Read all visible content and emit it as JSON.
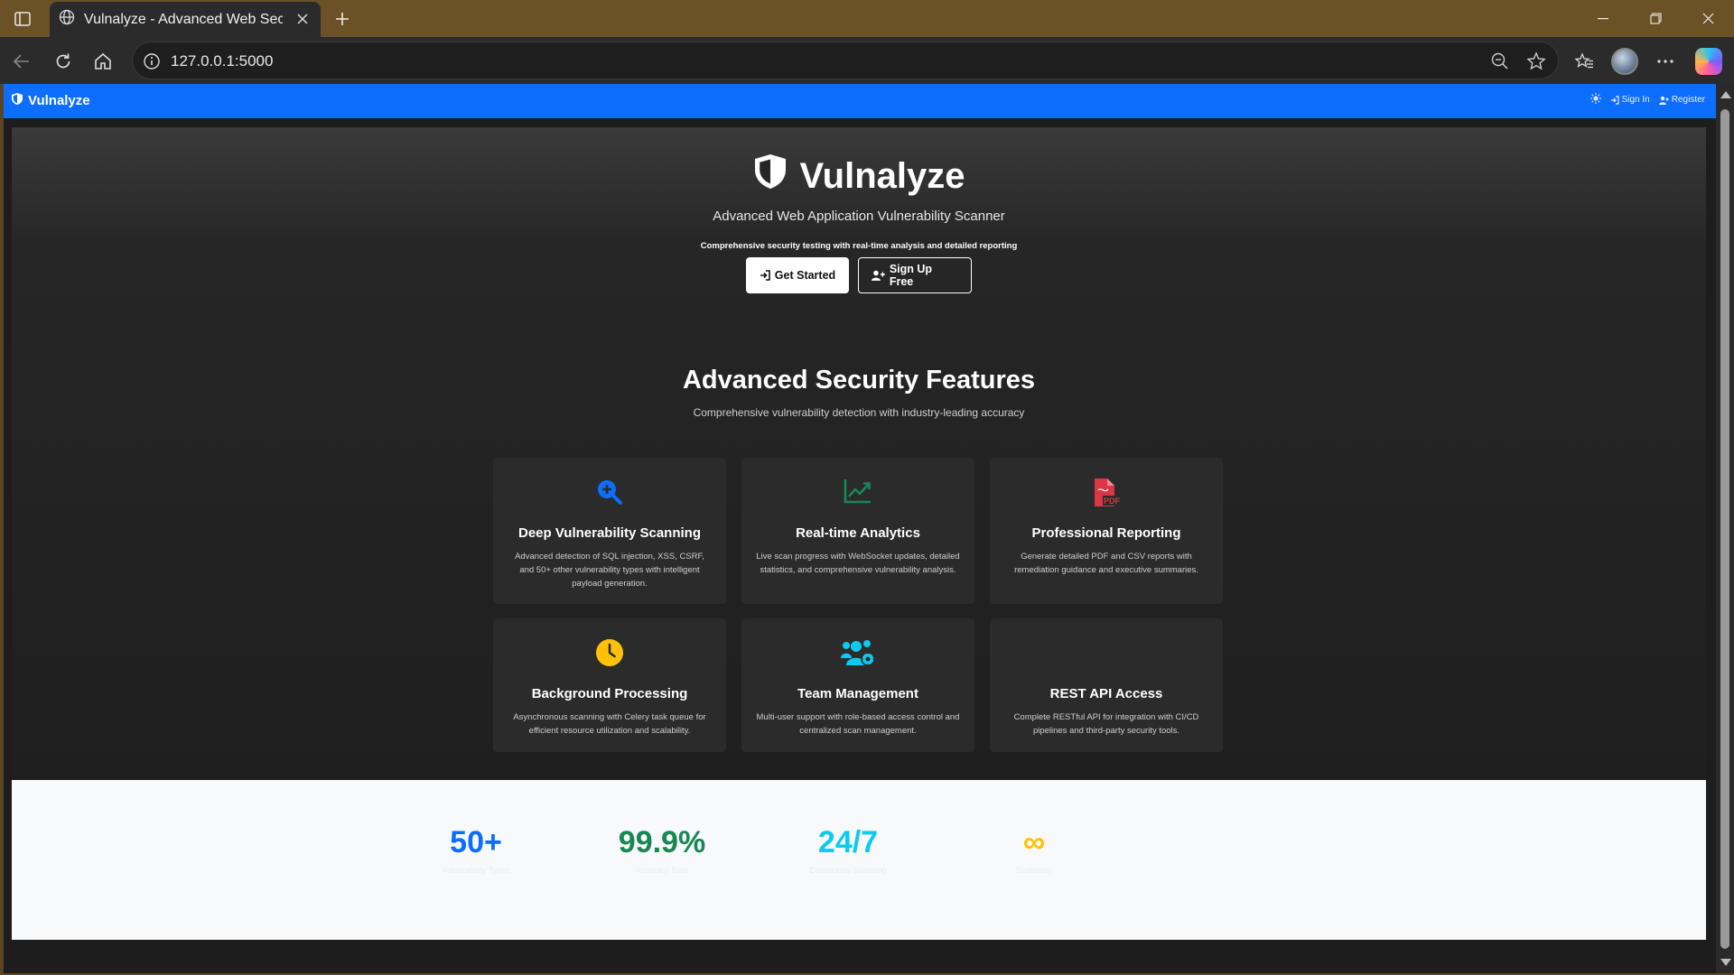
{
  "browser": {
    "tab_title": "Vulnalyze - Advanced Web Security Scanner",
    "url": "127.0.0.1:5000"
  },
  "navbar": {
    "brand": "Vulnalyze",
    "sign_in": "Sign In",
    "register": "Register"
  },
  "hero": {
    "title": "Vulnalyze",
    "subtitle": "Advanced Web Application Vulnerability Scanner",
    "description": "Comprehensive security testing with real-time analysis and detailed reporting",
    "get_started": "Get Started",
    "sign_up": "Sign Up Free"
  },
  "features": {
    "title": "Advanced Security Features",
    "subtitle": "Comprehensive vulnerability detection with industry-leading accuracy",
    "cards": [
      {
        "title": "Deep Vulnerability Scanning",
        "text": "Advanced detection of SQL injection, XSS, CSRF, and 50+ other vulnerability types with intelligent payload generation.",
        "icon": "search-plus-icon",
        "color": "#0d6efd"
      },
      {
        "title": "Real-time Analytics",
        "text": "Live scan progress with WebSocket updates, detailed statistics, and comprehensive vulnerability analysis.",
        "icon": "line-chart-icon",
        "color": "#198754"
      },
      {
        "title": "Professional Reporting",
        "text": "Generate detailed PDF and CSV reports with remediation guidance and executive summaries.",
        "icon": "pdf-file-icon",
        "color": "#dc3545"
      },
      {
        "title": "Background Processing",
        "text": "Asynchronous scanning with Celery task queue for efficient resource utilization and scalability.",
        "icon": "clock-icon",
        "color": "#ffc107"
      },
      {
        "title": "Team Management",
        "text": "Multi-user support with role-based access control and centralized scan management.",
        "icon": "users-cog-icon",
        "color": "#0dcaf0"
      },
      {
        "title": "REST API Access",
        "text": "Complete RESTful API for integration with CI/CD pipelines and third-party security tools.",
        "icon": "code-icon",
        "color": "#6c757d"
      }
    ]
  },
  "stats": [
    {
      "value": "50+",
      "label": "Vulnerability Types",
      "color": "#0d6efd"
    },
    {
      "value": "99.9%",
      "label": "Accuracy Rate",
      "color": "#198754"
    },
    {
      "value": "24/7",
      "label": "Continuous Scanning",
      "color": "#0dcaf0"
    },
    {
      "value": "∞",
      "label": "Scalability",
      "color": "#ffc107"
    }
  ]
}
